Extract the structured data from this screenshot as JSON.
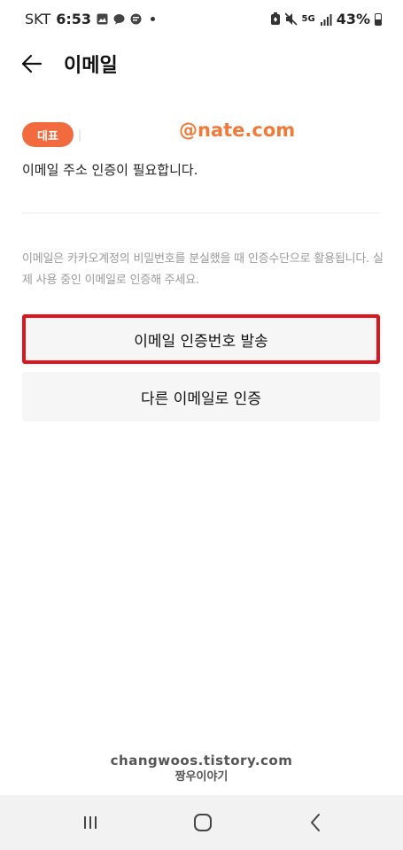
{
  "status_bar": {
    "carrier": "SKT",
    "time": "6:53",
    "battery": "43%",
    "network": "5G"
  },
  "header": {
    "title": "이메일"
  },
  "email": {
    "badge": "대표",
    "domain": "@nate.com",
    "verify_notice": "이메일 주소 인증이 필요합니다."
  },
  "help": {
    "text": "이메일은 카카오계정의 비밀번호를 분실했을 때 인증수단으로 활용됩니다. 실제 사용 중인 이메일로 인증해 주세요."
  },
  "actions": {
    "send_code": "이메일 인증번호 발송",
    "other_email": "다른 이메일로 인증"
  },
  "watermark": {
    "url": "changwoos.tistory.com",
    "name": "짱우이야기"
  },
  "colors": {
    "accent": "#f16b3f",
    "highlight_border": "#e0141e",
    "button_bg": "#f6f6f6"
  },
  "icons": {
    "back": "arrow-left-icon",
    "nav_recent": "recent-apps-icon",
    "nav_home": "home-icon",
    "nav_back": "chevron-left-icon"
  }
}
